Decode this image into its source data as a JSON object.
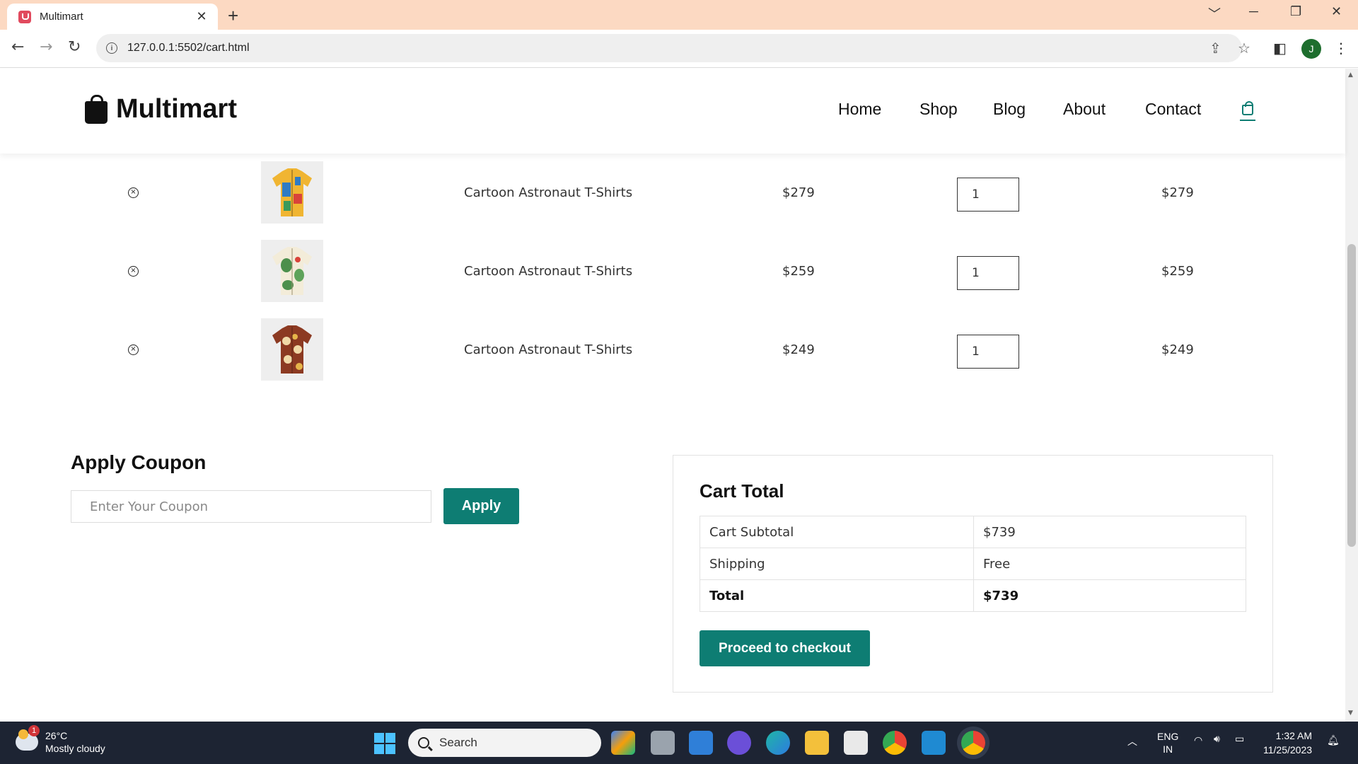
{
  "browser": {
    "tab_title": "Multimart",
    "tab_close": "✕",
    "new_tab": "+",
    "url": "127.0.0.1:5502/cart.html",
    "window_controls": [
      "﹀",
      "─",
      "❐",
      "✕"
    ]
  },
  "site": {
    "logo_text": "Multimart",
    "nav": [
      "Home",
      "Shop",
      "Blog",
      "About",
      "Contact"
    ],
    "accent_color": "#0e7d73"
  },
  "cart": {
    "items": [
      {
        "name": "Cartoon Astronaut T-Shirts",
        "price": "$279",
        "quantity": "1",
        "subtotal": "$279"
      },
      {
        "name": "Cartoon Astronaut T-Shirts",
        "price": "$259",
        "quantity": "1",
        "subtotal": "$259"
      },
      {
        "name": "Cartoon Astronaut T-Shirts",
        "price": "$249",
        "quantity": "1",
        "subtotal": "$249"
      }
    ]
  },
  "coupon": {
    "title": "Apply Coupon",
    "placeholder": "Enter Your Coupon",
    "button": "Apply"
  },
  "totals": {
    "title": "Cart Total",
    "rows": [
      {
        "label": "Cart Subtotal",
        "value": "$739"
      },
      {
        "label": "Shipping",
        "value": "Free"
      },
      {
        "label": "Total",
        "value": "$739"
      }
    ],
    "checkout_button": "Proceed to checkout"
  },
  "taskbar": {
    "weather_temp": "26°C",
    "weather_desc": "Mostly cloudy",
    "weather_badge": "1",
    "search_placeholder": "Search",
    "language": "ENG",
    "region": "IN",
    "time": "1:32 AM",
    "date": "11/25/2023"
  }
}
